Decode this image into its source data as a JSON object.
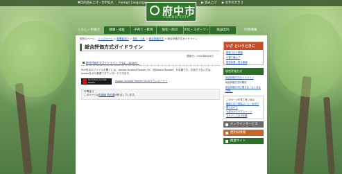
{
  "header": {
    "top_links": [
      "▼音声読み上げ・文字拡大",
      "Foreign Language"
    ],
    "right_links": [
      "▶ 読み上げ",
      "▶ 文字の大きさ"
    ],
    "logo_name": "府中市",
    "logo_sub": "FUCHU CITY"
  },
  "nav": {
    "left_item": "くらし・手続き",
    "items": [
      "健康・福祉",
      "子育て・教育",
      "防犯・防災",
      "文化・スポーツ・生涯学習",
      "施設案内"
    ],
    "right_item": "行政情報"
  },
  "breadcrumb": {
    "label": "現在のページ：",
    "items": [
      "トップページ",
      "事業者向け",
      "契約・入札",
      "総合評価方式",
      "総合評価方式ガイドライン"
    ]
  },
  "page": {
    "title": "総合評価方式ガイドライン",
    "updated": "更新日：2020年8月4日",
    "doc_link": "総合評価方式ガイドライン（PDF：358KB）",
    "pdf_note": "PDF形式のファイルを開くには、Adobe Acrobat Reader DC（旧Adobe Reader）が必要です。お持ちでない方は、Adobe社から無償でダウンロードできます。",
    "acrobat_badge": "Get Adobe Acrobat Reader",
    "acrobat_link": "Adobe Acrobat Reader DCのダウンロードへ",
    "inquiry_title": "お問合せ",
    "inquiry_text": "このページは",
    "inquiry_link": "財務部 契約課",
    "inquiry_tail": "が担当しています。"
  },
  "sidebar": {
    "emergency_title": "いざ というときに",
    "emergency_items": [
      "新型コロナ関連",
      "災害に備えて",
      "防犯対策・防災無線"
    ],
    "section_title": "総合評価方式",
    "section_items": [
      "総合評価方式ガイドライン"
    ],
    "other_items": [
      "総合評価方式の検討",
      "総合評価方式に関する「よくある質問」"
    ],
    "question_title": "このページを見て良い点は",
    "question_links": [
      "機能に応じ閲覧メニューを切り替えるので",
      "大変分かりやすいページ",
      "もう少し工夫が必要"
    ],
    "services": [
      {
        "label": "オンラインサービス",
        "color": "#6b6b6b"
      },
      {
        "label": "便利な情報",
        "color": "#c7662a"
      },
      {
        "label": "関連サイト",
        "color": "#2f6d2a"
      }
    ]
  }
}
